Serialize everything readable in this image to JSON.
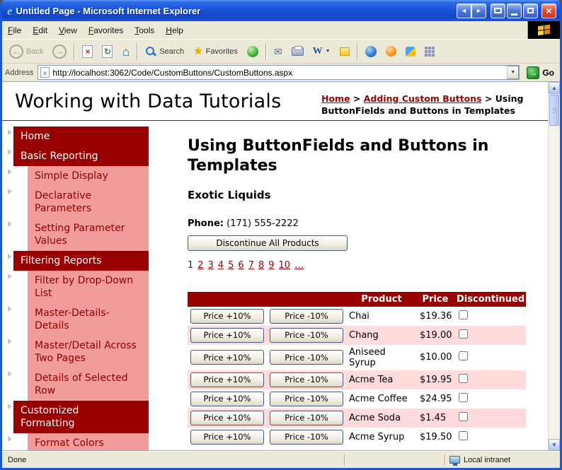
{
  "icons": {
    "ie_logo": "e",
    "nav_left": "◄",
    "nav_right": "►",
    "close": "×",
    "back_arrow": "←",
    "forward_arrow": "→",
    "stop": "×",
    "refresh": "↻",
    "home": "⌂",
    "favorites_star": "★",
    "mail": "✉",
    "edit_dropdown": "▼",
    "address_dropdown": "▼",
    "go_arrow": "→",
    "scroll_up": "▲",
    "scroll_down": "▼",
    "page": "e"
  },
  "colors": {
    "titlebar_blue": "#1A53D8",
    "window_border": "#1C57D4",
    "chrome_gray": "#ECE9D8",
    "maroon": "#990000",
    "sidebar_pink": "#F19B9B",
    "grid_alt_pink": "#FFDBDB",
    "close_red": "#BE3A20",
    "go_green": "#2F9E3F"
  },
  "window": {
    "title": "Untitled Page - Microsoft Internet Explorer"
  },
  "menu_bar": {
    "items": [
      "File",
      "Edit",
      "View",
      "Favorites",
      "Tools",
      "Help"
    ]
  },
  "toolbar": {
    "back": "Back",
    "search": "Search",
    "favorites": "Favorites",
    "edit_w": "W"
  },
  "address_bar": {
    "label": "Address",
    "url": "http://localhost:3062/Code/CustomButtons/CustomButtons.aspx",
    "go": "Go"
  },
  "page": {
    "site_title": "Working with Data Tutorials",
    "breadcrumb": {
      "link1": "Home",
      "sep1": ">",
      "link2": "Adding Custom Buttons",
      "sep2": ">",
      "current": "Using ButtonFields and Buttons in Templates"
    },
    "sidebar": [
      {
        "label": "Home",
        "type": "section"
      },
      {
        "label": "Basic Reporting",
        "type": "section"
      },
      {
        "label": "Simple Display",
        "type": "link"
      },
      {
        "label": "Declarative Parameters",
        "type": "link"
      },
      {
        "label": "Setting Parameter Values",
        "type": "link"
      },
      {
        "label": "Filtering Reports",
        "type": "section"
      },
      {
        "label": "Filter by Drop-Down List",
        "type": "link"
      },
      {
        "label": "Master-Details-Details",
        "type": "link"
      },
      {
        "label": "Master/Detail Across Two Pages",
        "type": "link"
      },
      {
        "label": "Details of Selected Row",
        "type": "link"
      },
      {
        "label": "Customized Formatting",
        "type": "section"
      },
      {
        "label": "Format Colors",
        "type": "link"
      }
    ],
    "content": {
      "heading": "Using ButtonFields and Buttons in Templates",
      "supplier": "Exotic Liquids",
      "phone_label": "Phone:",
      "phone_value": "(171) 555-2222",
      "discontinue_all": "Discontinue All Products",
      "pager": {
        "current": "1",
        "links": [
          "2",
          "3",
          "4",
          "5",
          "6",
          "7",
          "8",
          "9",
          "10",
          "…"
        ]
      },
      "grid": {
        "headers": {
          "product": "Product",
          "price": "Price",
          "discontinued": "Discontinued"
        },
        "increase": "Price +10%",
        "decrease": "Price -10%",
        "rows": [
          {
            "product": "Chai",
            "price": "$19.36"
          },
          {
            "product": "Chang",
            "price": "$19.00"
          },
          {
            "product": "Aniseed Syrup",
            "price": "$10.00"
          },
          {
            "product": "Acme Tea",
            "price": "$19.95"
          },
          {
            "product": "Acme Coffee",
            "price": "$24.95"
          },
          {
            "product": "Acme Soda",
            "price": "$1.45"
          },
          {
            "product": "Acme Syrup",
            "price": "$19.50"
          }
        ]
      }
    }
  },
  "status_bar": {
    "left": "Done",
    "right": "Local intranet"
  }
}
